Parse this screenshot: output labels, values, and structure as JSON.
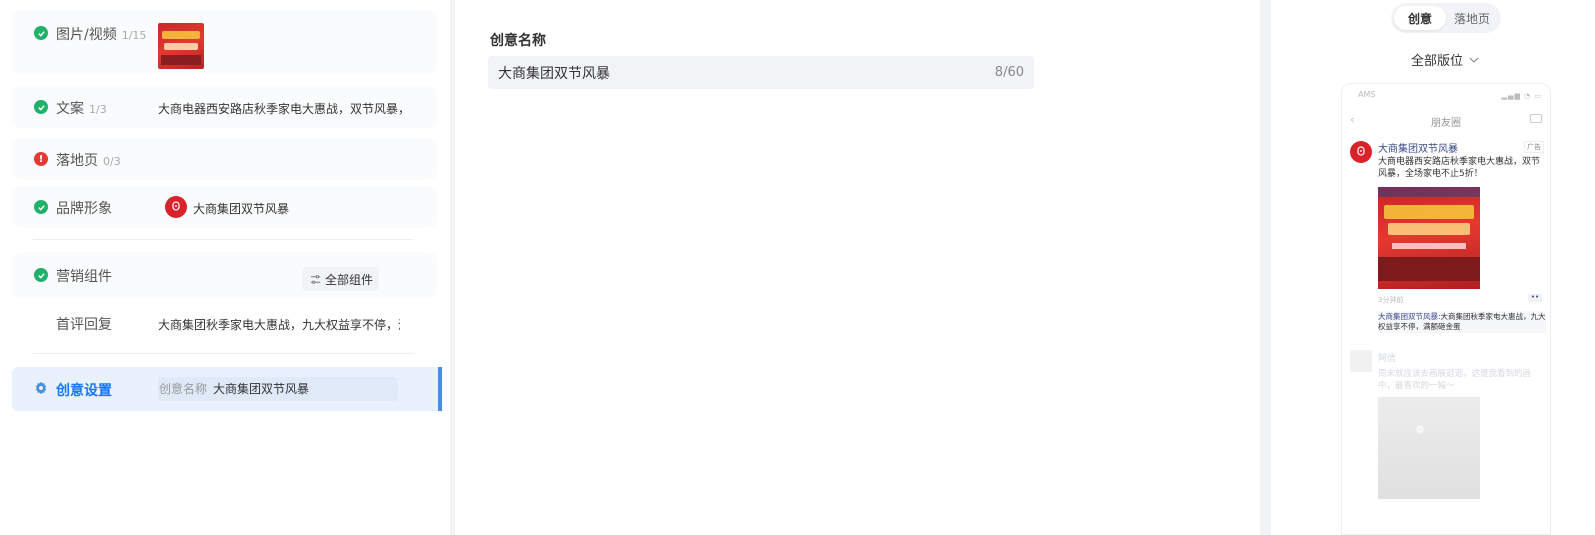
{
  "left_panel": {
    "media": {
      "label": "图片/视频",
      "count": "1/15"
    },
    "copy": {
      "label": "文案",
      "count": "1/3",
      "value": "大商电器西安路店秋季家电大惠战，双节风暴，"
    },
    "landing": {
      "label": "落地页",
      "count": "0/3"
    },
    "brand": {
      "label": "品牌形象",
      "value": "大商集团双节风暴"
    },
    "marketing": {
      "label": "营销组件",
      "all_button": "全部组件"
    },
    "first_reply": {
      "label": "首评回复",
      "value": "大商集团秋季家电大惠战，九大权益享不停，满"
    },
    "creative_setting": {
      "label": "创意设置",
      "sub_key": "创意名称",
      "sub_value": "大商集团双节风暴"
    }
  },
  "middle_panel": {
    "title": "创意名称",
    "input_value": "大商集团双节风暴",
    "input_count": "8/60"
  },
  "right_panel": {
    "tabs": [
      "创意",
      "落地页"
    ],
    "active_tab": "创意",
    "position_select": "全部版位",
    "preview": {
      "status_left": "AMS",
      "nav_title": "朋友圈",
      "brand_name": "大商集团双节风暴",
      "ad_tag": "广告",
      "ad_text": "大商电器西安路店秋季家电大惠战，双节风暴，全场家电不止5折！",
      "time": "3分钟前",
      "comment_user": "大商集团双节风暴:",
      "comment_text": "大商集团秋季家电大惠战，九大权益享不停，满额砸金蛋",
      "friend_name": "阿信",
      "friend_text": "周末就应该去画展逛逛，这是我看到的画中，最喜欢的一幅～"
    }
  },
  "colors": {
    "accent": "#1677ff",
    "success": "#20b26b",
    "error": "#e53935",
    "brand_red": "#d9232b"
  }
}
